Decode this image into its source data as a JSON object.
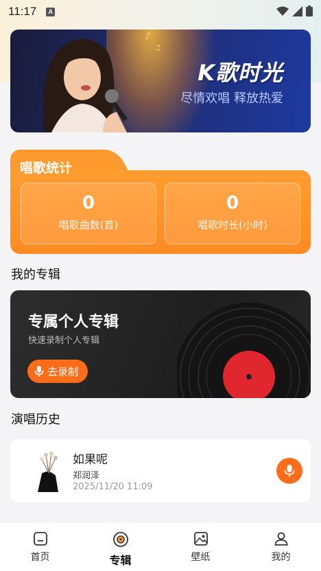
{
  "status_bar": {
    "time": "11:17",
    "notification_icon": "A"
  },
  "banner": {
    "title": "K歌时光",
    "subtitle": "尽情欢唱 释放热爱"
  },
  "stats": {
    "title": "唱歌统计",
    "items": [
      {
        "value": "0",
        "label": "唱歌曲数(首)"
      },
      {
        "value": "0",
        "label": "唱歌时长(小时)"
      }
    ]
  },
  "my_album": {
    "section_title": "我的专辑",
    "card_title": "专属个人专辑",
    "card_subtitle": "快速录制个人专辑",
    "record_button": "去录制"
  },
  "history": {
    "section_title": "演唱历史",
    "items": [
      {
        "title": "如果呢",
        "artist": "郑润泽",
        "time": "2025/11/20 11:09"
      }
    ]
  },
  "bottom_nav": {
    "items": [
      {
        "label": "首页",
        "icon": "home-icon"
      },
      {
        "label": "专辑",
        "icon": "album-icon",
        "active": true
      },
      {
        "label": "壁纸",
        "icon": "wallpaper-icon"
      },
      {
        "label": "我的",
        "icon": "profile-icon"
      }
    ]
  },
  "colors": {
    "accent": "#ff6d1a",
    "stats_orange": "#ff9b2e",
    "banner_blue": "#1f2b6e"
  }
}
